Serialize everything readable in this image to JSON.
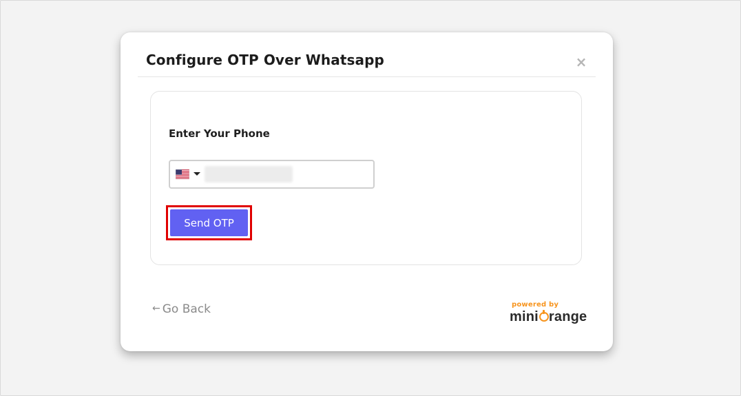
{
  "modal": {
    "title": "Configure OTP Over Whatsapp",
    "close_label": "×"
  },
  "phone_form": {
    "label": "Enter Your Phone",
    "country_flag": "flag-us-icon",
    "country_code": "US",
    "phone_value": "",
    "phone_placeholder": ""
  },
  "actions": {
    "send_otp_label": "Send OTP",
    "go_back_arrow": "←",
    "go_back_label": "Go Back"
  },
  "branding": {
    "powered_by": "powered by",
    "name_prefix": "mini",
    "name_suffix": "range",
    "accent_color": "#f7941d"
  },
  "colors": {
    "primary_button": "#6161f2",
    "highlight_border": "#e00000"
  }
}
